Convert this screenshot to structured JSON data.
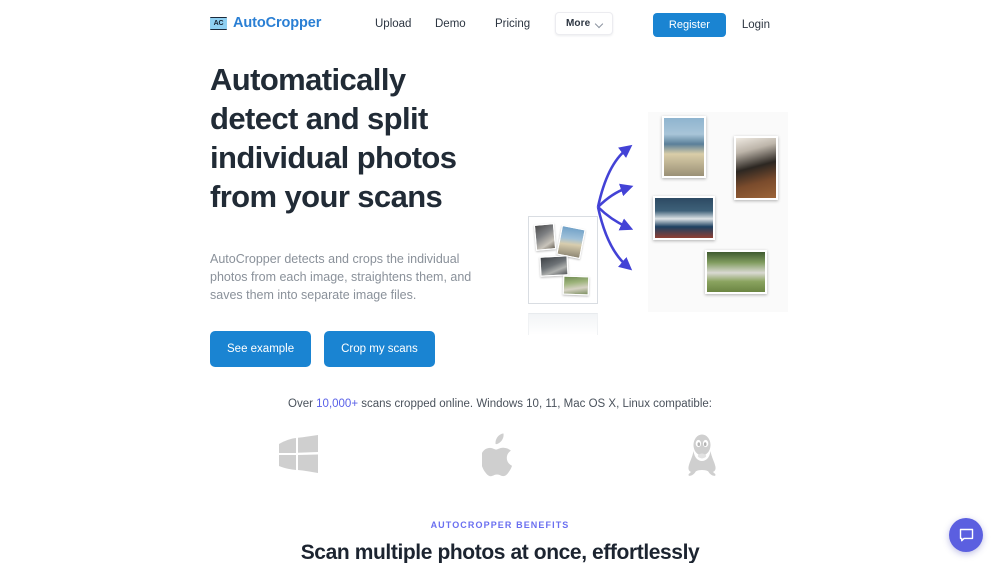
{
  "header": {
    "brand": {
      "mark_text": "AC",
      "name": "AutoCropper"
    },
    "nav": [
      {
        "label": "Upload"
      },
      {
        "label": "Demo"
      },
      {
        "label": "Pricing"
      }
    ],
    "more": {
      "label": "More",
      "icon": "chevron-down-icon"
    },
    "register_label": "Register",
    "login_label": "Login",
    "accent_blue": "#1a84d2"
  },
  "hero": {
    "title": "Automatically detect and split individual photos from your scans",
    "subtitle": "AutoCropper detects and crops the individual photos from each image, straightens them, and saves them into separate image files.",
    "primary_button": "See example",
    "secondary_button": "Crop my scans",
    "illustration": {
      "alt": "scan-to-photos-illustration",
      "arrow_color": "#4342d6",
      "arrow_count": 4,
      "source_photo_count": 4,
      "output_photo_count": 4
    }
  },
  "proof": {
    "prefix": "Over ",
    "count": "10,000+",
    "suffix": " scans cropped online. Windows 10, 11, Mac OS X, Linux compatible:",
    "highlight_color": "#5a61e8",
    "platforms": [
      {
        "name": "windows-icon",
        "label": "Windows"
      },
      {
        "name": "apple-icon",
        "label": "Mac OS X"
      },
      {
        "name": "linux-icon",
        "label": "Linux"
      }
    ]
  },
  "benefits": {
    "eyebrow": "AUTOCROPPER BENEFITS",
    "title": "Scan multiple photos at once, effortlessly",
    "eyebrow_color": "#6a6ff0"
  },
  "chat": {
    "icon": "chat-bubble-icon",
    "color": "#5b5fe0"
  }
}
